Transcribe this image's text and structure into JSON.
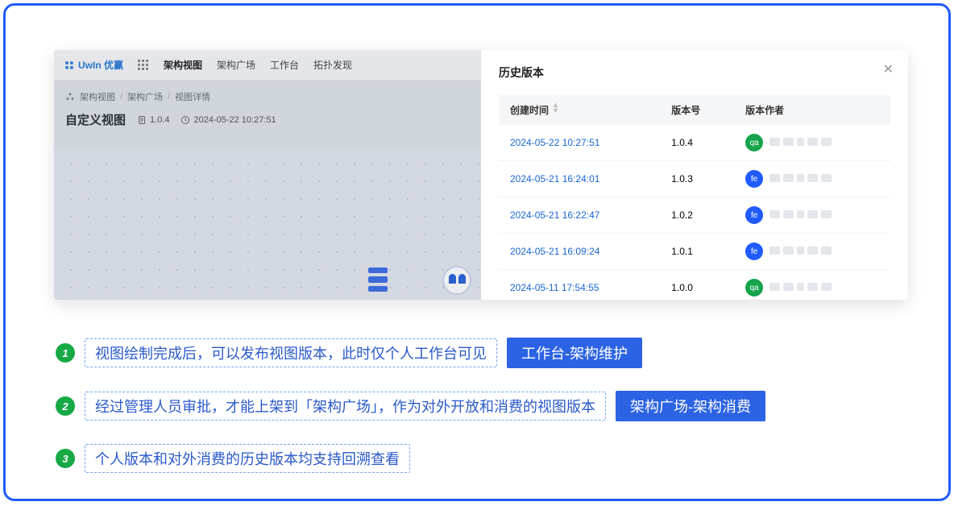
{
  "app": {
    "brand": "UwIn 优赢",
    "nav": [
      "架构视图",
      "架构广场",
      "工作台",
      "拓扑发现"
    ],
    "breadcrumb": [
      "架构视图",
      "架构广场",
      "视图详情"
    ],
    "page_title": "自定义视图",
    "version_badge": "1.0.4",
    "timestamp_badge": "2024-05-22 10:27:51"
  },
  "drawer": {
    "title": "历史版本",
    "columns": {
      "created": "创建时间",
      "version": "版本号",
      "author": "版本作者"
    },
    "rows": [
      {
        "created": "2024-05-22 10:27:51",
        "version": "1.0.4",
        "tag": "qa",
        "tagColor": "qa"
      },
      {
        "created": "2024-05-21 16:24:01",
        "version": "1.0.3",
        "tag": "fe",
        "tagColor": "fe"
      },
      {
        "created": "2024-05-21 16:22:47",
        "version": "1.0.2",
        "tag": "fe",
        "tagColor": "fe"
      },
      {
        "created": "2024-05-21 16:09:24",
        "version": "1.0.1",
        "tag": "fe",
        "tagColor": "fe"
      },
      {
        "created": "2024-05-11 17:54:55",
        "version": "1.0.0",
        "tag": "qa",
        "tagColor": "qa"
      }
    ]
  },
  "notes": [
    {
      "n": "1",
      "text": "视图绘制完成后，可以发布视图版本，此时仅个人工作台可见",
      "btn": "工作台-架构维护"
    },
    {
      "n": "2",
      "text": "经过管理人员审批，才能上架到「架构广场」，作为对外开放和消费的视图版本",
      "btn": "架构广场-架构消费"
    },
    {
      "n": "3",
      "text": "个人版本和对外消费的历史版本均支持回溯查看",
      "btn": null
    }
  ]
}
